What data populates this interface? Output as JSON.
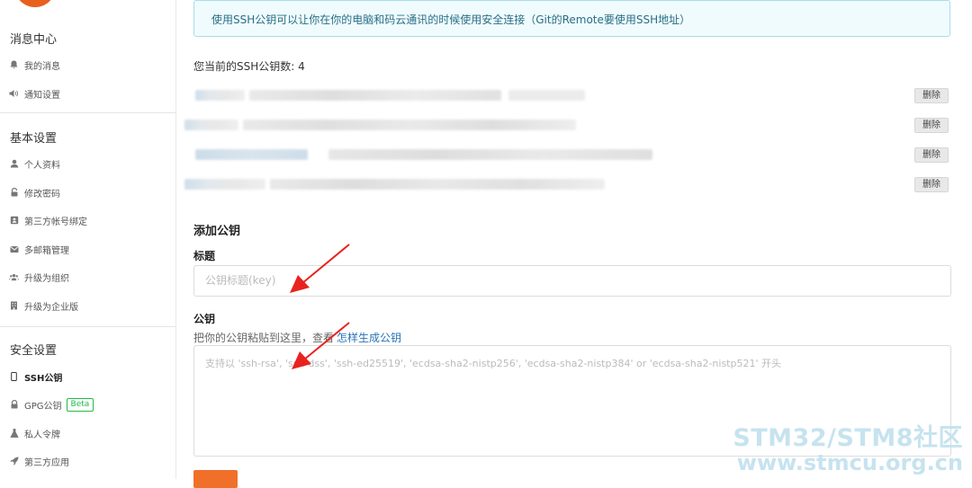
{
  "sidebar": {
    "sections": [
      {
        "title": "消息中心",
        "items": [
          {
            "label": "我的消息",
            "icon": "bell-icon"
          },
          {
            "label": "通知设置",
            "icon": "volume-icon"
          }
        ]
      },
      {
        "title": "基本设置",
        "items": [
          {
            "label": "个人资料",
            "icon": "user-icon"
          },
          {
            "label": "修改密码",
            "icon": "unlock-icon"
          },
          {
            "label": "第三方帐号绑定",
            "icon": "id-card-icon"
          },
          {
            "label": "多邮箱管理",
            "icon": "envelope-icon"
          },
          {
            "label": "升级为组织",
            "icon": "users-icon"
          },
          {
            "label": "升级为企业版",
            "icon": "building-icon"
          }
        ]
      },
      {
        "title": "安全设置",
        "items": [
          {
            "label": "SSH公钥",
            "icon": "phone-icon",
            "active": true
          },
          {
            "label": "GPG公钥",
            "icon": "lock-icon",
            "badge": "Beta"
          },
          {
            "label": "私人令牌",
            "icon": "flask-icon"
          },
          {
            "label": "第三方应用",
            "icon": "rocket-icon"
          }
        ]
      }
    ]
  },
  "notice": "使用SSH公钥可以让你在你的电脑和码云通讯的时候使用安全连接（Git的Remote要使用SSH地址）",
  "keys": {
    "count_label": "您当前的SSH公钥数: 4",
    "delete_label": "删除"
  },
  "add_key": {
    "heading": "添加公钥",
    "title_label": "标题",
    "title_placeholder": "公钥标题(key)",
    "key_label": "公钥",
    "hint_text": "把你的公钥粘贴到这里，查看",
    "hint_link": "怎样生成公钥",
    "key_placeholder": "支持以 'ssh-rsa', 'ssh-dss', 'ssh-ed25519', 'ecdsa-sha2-nistp256', 'ecdsa-sha2-nistp384' or 'ecdsa-sha2-nistp521' 开头"
  },
  "watermark": {
    "line1": "STM32/STM8社区",
    "line2": "www.stmcu.org.cn"
  },
  "colors": {
    "accent": "#f0702a",
    "annotation_arrow": "#e8231f",
    "link": "#2873b8"
  }
}
